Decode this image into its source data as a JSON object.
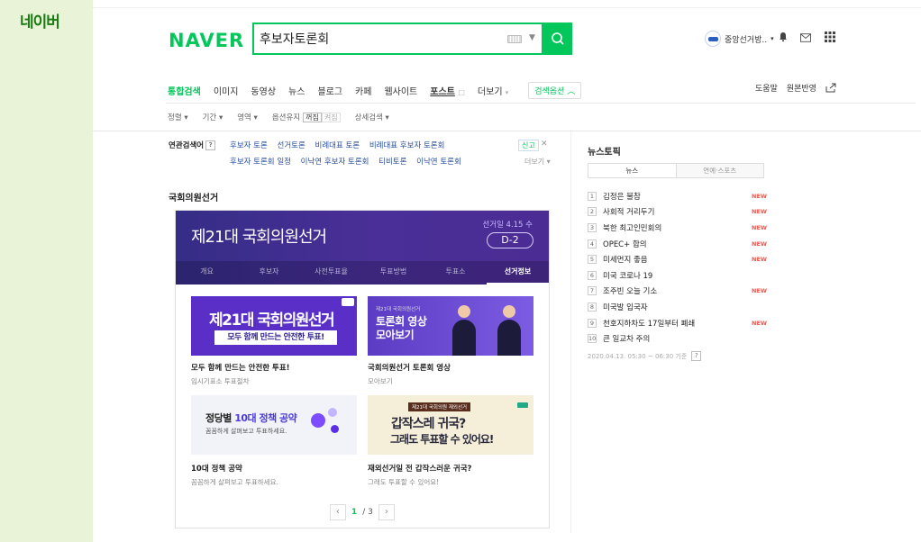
{
  "app": {
    "name": "네이버"
  },
  "header": {
    "logo": "NAVER",
    "search_value": "후보자토론회",
    "profile_name": "중앙선거방.."
  },
  "tabs": [
    {
      "label": "통합검색",
      "active": true
    },
    {
      "label": "이미지"
    },
    {
      "label": "동영상"
    },
    {
      "label": "뉴스"
    },
    {
      "label": "블로그"
    },
    {
      "label": "카페"
    },
    {
      "label": "웹사이트"
    },
    {
      "label": "포스트"
    },
    {
      "label": "더보기"
    }
  ],
  "search_option": "검색옵션",
  "util": {
    "help": "도움말",
    "feedback": "원본반영"
  },
  "filters": {
    "sort": "정렬",
    "period": "기간",
    "area": "영역",
    "option_keep": "옵션유지",
    "on": "꺼짐",
    "off": "켜짐",
    "detail": "상세검색"
  },
  "related": {
    "label": "연관검색어",
    "help": "?",
    "row1": [
      "후보자 토론",
      "선거토론",
      "비례대표 토론",
      "비례대표 후보자 토론회"
    ],
    "row2": [
      "후보자 토론회 일정",
      "이낙연 후보자 토론회",
      "티비토론",
      "이낙연 토론회"
    ],
    "report": "신고",
    "close": "✕",
    "more": "더보기"
  },
  "election": {
    "section_title": "국회의원선거",
    "banner_title": "제21대 국회의원선거",
    "banner_date": "선거일 4.15 수",
    "dday": "D-2",
    "subnav": [
      "개요",
      "후보자",
      "사전투표율",
      "투표방법",
      "투표소",
      "선거정보"
    ],
    "subnav_active": 5,
    "tile1": {
      "big": "제21대 국회의원선거",
      "pill_prefix": "모두 함께 만드는 ",
      "pill_strong": "안전한 투표!"
    },
    "tile2": {
      "small": "제21대 국회의원선거",
      "line1": "토론회 영상",
      "line2": "모아보기"
    },
    "tile3": {
      "big_prefix": "정당별 ",
      "big_hl": "10대 정책 공약",
      "small": "꼼꼼하게 살펴보고 투표하세요."
    },
    "tile4": {
      "tag": "제21대 국회의원 재외선거",
      "line1": "갑작스레 귀국?",
      "line2": "그래도 투표할 수 있어요!"
    },
    "captions": [
      {
        "title": "모두 함께 만드는 안전한 투표!",
        "sub": "임시기표소 투표절차"
      },
      {
        "title": "국회의원선거 토론회 영상",
        "sub": "모아보기"
      },
      {
        "title": "10대 정책 공약",
        "sub": "꼼꼼하게 살펴보고 투표하세요."
      },
      {
        "title": "재외선거일 전 갑작스러운 귀국?",
        "sub": "그래도 투표할 수 있어요!"
      }
    ],
    "pager": {
      "current": "1",
      "total": "/ 3"
    }
  },
  "news_topic": {
    "title": "뉴스토픽",
    "tabs": [
      "뉴스",
      "연예·스포츠"
    ],
    "items": [
      {
        "rank": "1",
        "text": "김정은 불참",
        "badge": "NEW"
      },
      {
        "rank": "2",
        "text": "사회적 거리두기",
        "badge": "NEW"
      },
      {
        "rank": "3",
        "text": "북한 최고인민회의",
        "badge": "NEW"
      },
      {
        "rank": "4",
        "text": "OPEC+ 합의",
        "badge": "NEW"
      },
      {
        "rank": "5",
        "text": "미세먼지 좋음",
        "badge": "NEW"
      },
      {
        "rank": "6",
        "text": "미국 코로나 19",
        "badge": ""
      },
      {
        "rank": "7",
        "text": "조주빈 오늘 기소",
        "badge": "NEW"
      },
      {
        "rank": "8",
        "text": "미국발 입국자",
        "badge": ""
      },
      {
        "rank": "9",
        "text": "천호지하차도 17일부터 폐쇄",
        "badge": "NEW"
      },
      {
        "rank": "10",
        "text": "큰 일교차 주의",
        "badge": ""
      }
    ],
    "time": "2020.04.13. 05:30 ~ 06:30 기준"
  },
  "colors": {
    "brand": "#03c75a",
    "banner": "#3d2f8e",
    "new_badge": "#f0594e"
  }
}
